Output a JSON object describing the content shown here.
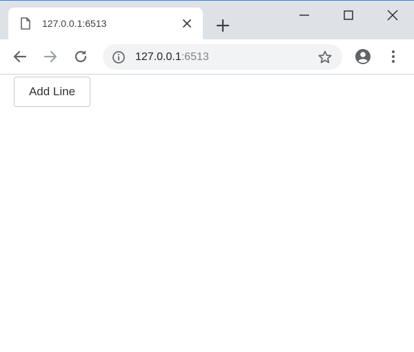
{
  "tab": {
    "title": "127.0.0.1:6513",
    "favicon": "page-icon",
    "close": "close-icon"
  },
  "window_controls": {
    "minimize": "minimize-icon",
    "maximize": "maximize-icon",
    "close": "close-icon"
  },
  "toolbar": {
    "back": "arrow-left-icon",
    "forward": "arrow-right-icon",
    "reload": "reload-icon",
    "info": "info-icon",
    "bookmark": "star-icon",
    "profile": "account-icon",
    "menu": "more-vert-icon"
  },
  "address_bar": {
    "host": "127.0.0.1",
    "port": ":6513"
  },
  "page": {
    "add_line_label": "Add Line"
  },
  "colors": {
    "tabstrip_bg": "#dee1e6",
    "omnibox_bg": "#f1f3f4",
    "icon_dark": "#5f6368",
    "icon_disabled": "#9aa0a6",
    "accent_line": "#2e86de"
  }
}
